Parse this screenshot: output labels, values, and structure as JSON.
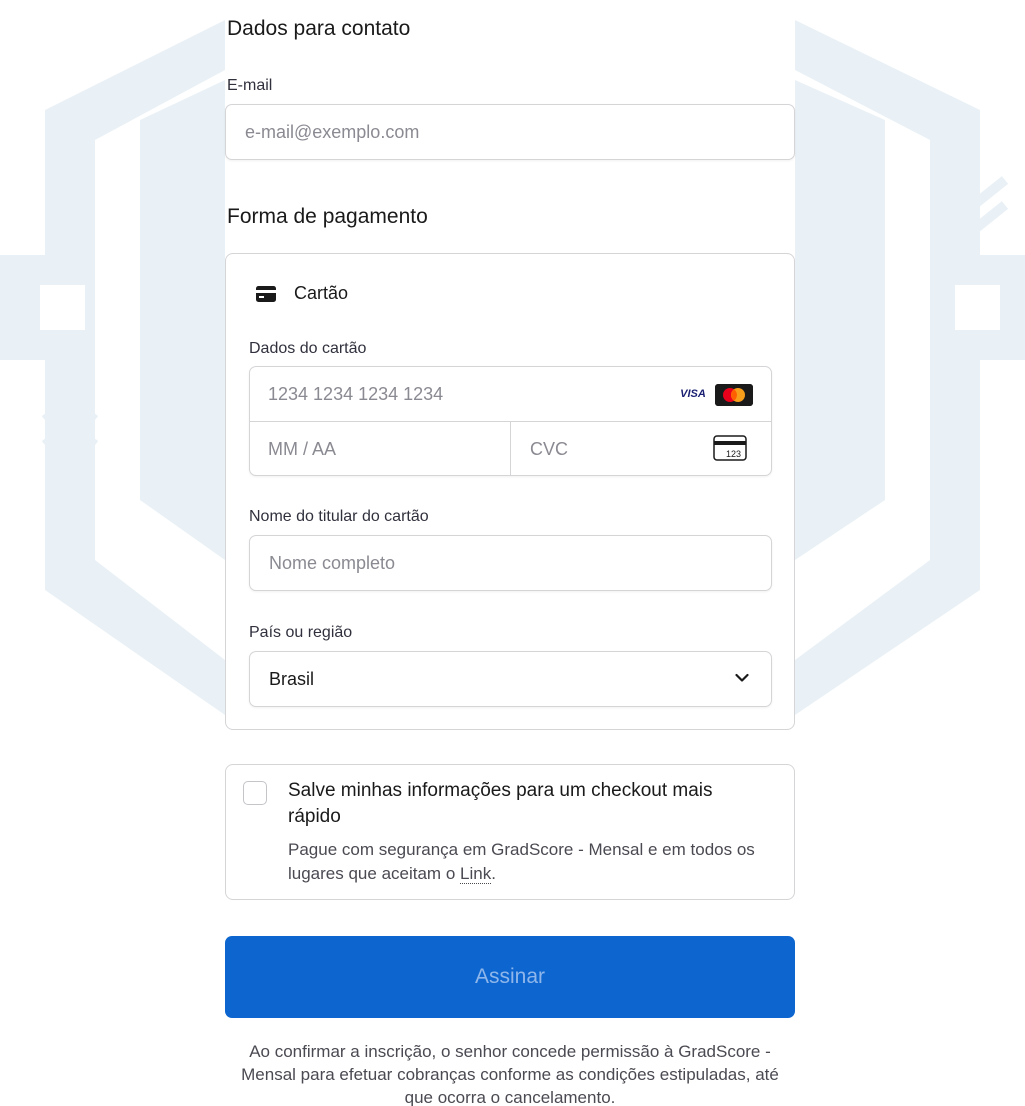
{
  "contact": {
    "title": "Dados para contato",
    "email_label": "E-mail",
    "email_placeholder": "e-mail@exemplo.com"
  },
  "payment": {
    "title": "Forma de pagamento",
    "method_label": "Cartão",
    "card_details_label": "Dados do cartão",
    "card_number_placeholder": "1234 1234 1234 1234",
    "expiry_placeholder": "MM / AA",
    "cvc_placeholder": "CVC",
    "card_brands": [
      "VISA",
      "Mastercard"
    ],
    "cvc_icon_text": "123",
    "holder_label": "Nome do titular do cartão",
    "holder_placeholder": "Nome completo",
    "country_label": "País ou região",
    "country_value": "Brasil"
  },
  "save_info": {
    "checked": false,
    "title": "Salve minhas informações para um checkout mais rápido",
    "description": "Pague com segurança em GradScore - Mensal e em todos os lugares que aceitam o",
    "link_text": "Link",
    "description_end": "."
  },
  "submit": {
    "label": "Assinar",
    "color": "#0d66d0"
  },
  "legal": {
    "text": "Ao confirmar a inscrição, o senhor concede permissão à GradScore - Mensal para efetuar cobranças conforme as condições estipuladas, até que ocorra o cancelamento."
  }
}
